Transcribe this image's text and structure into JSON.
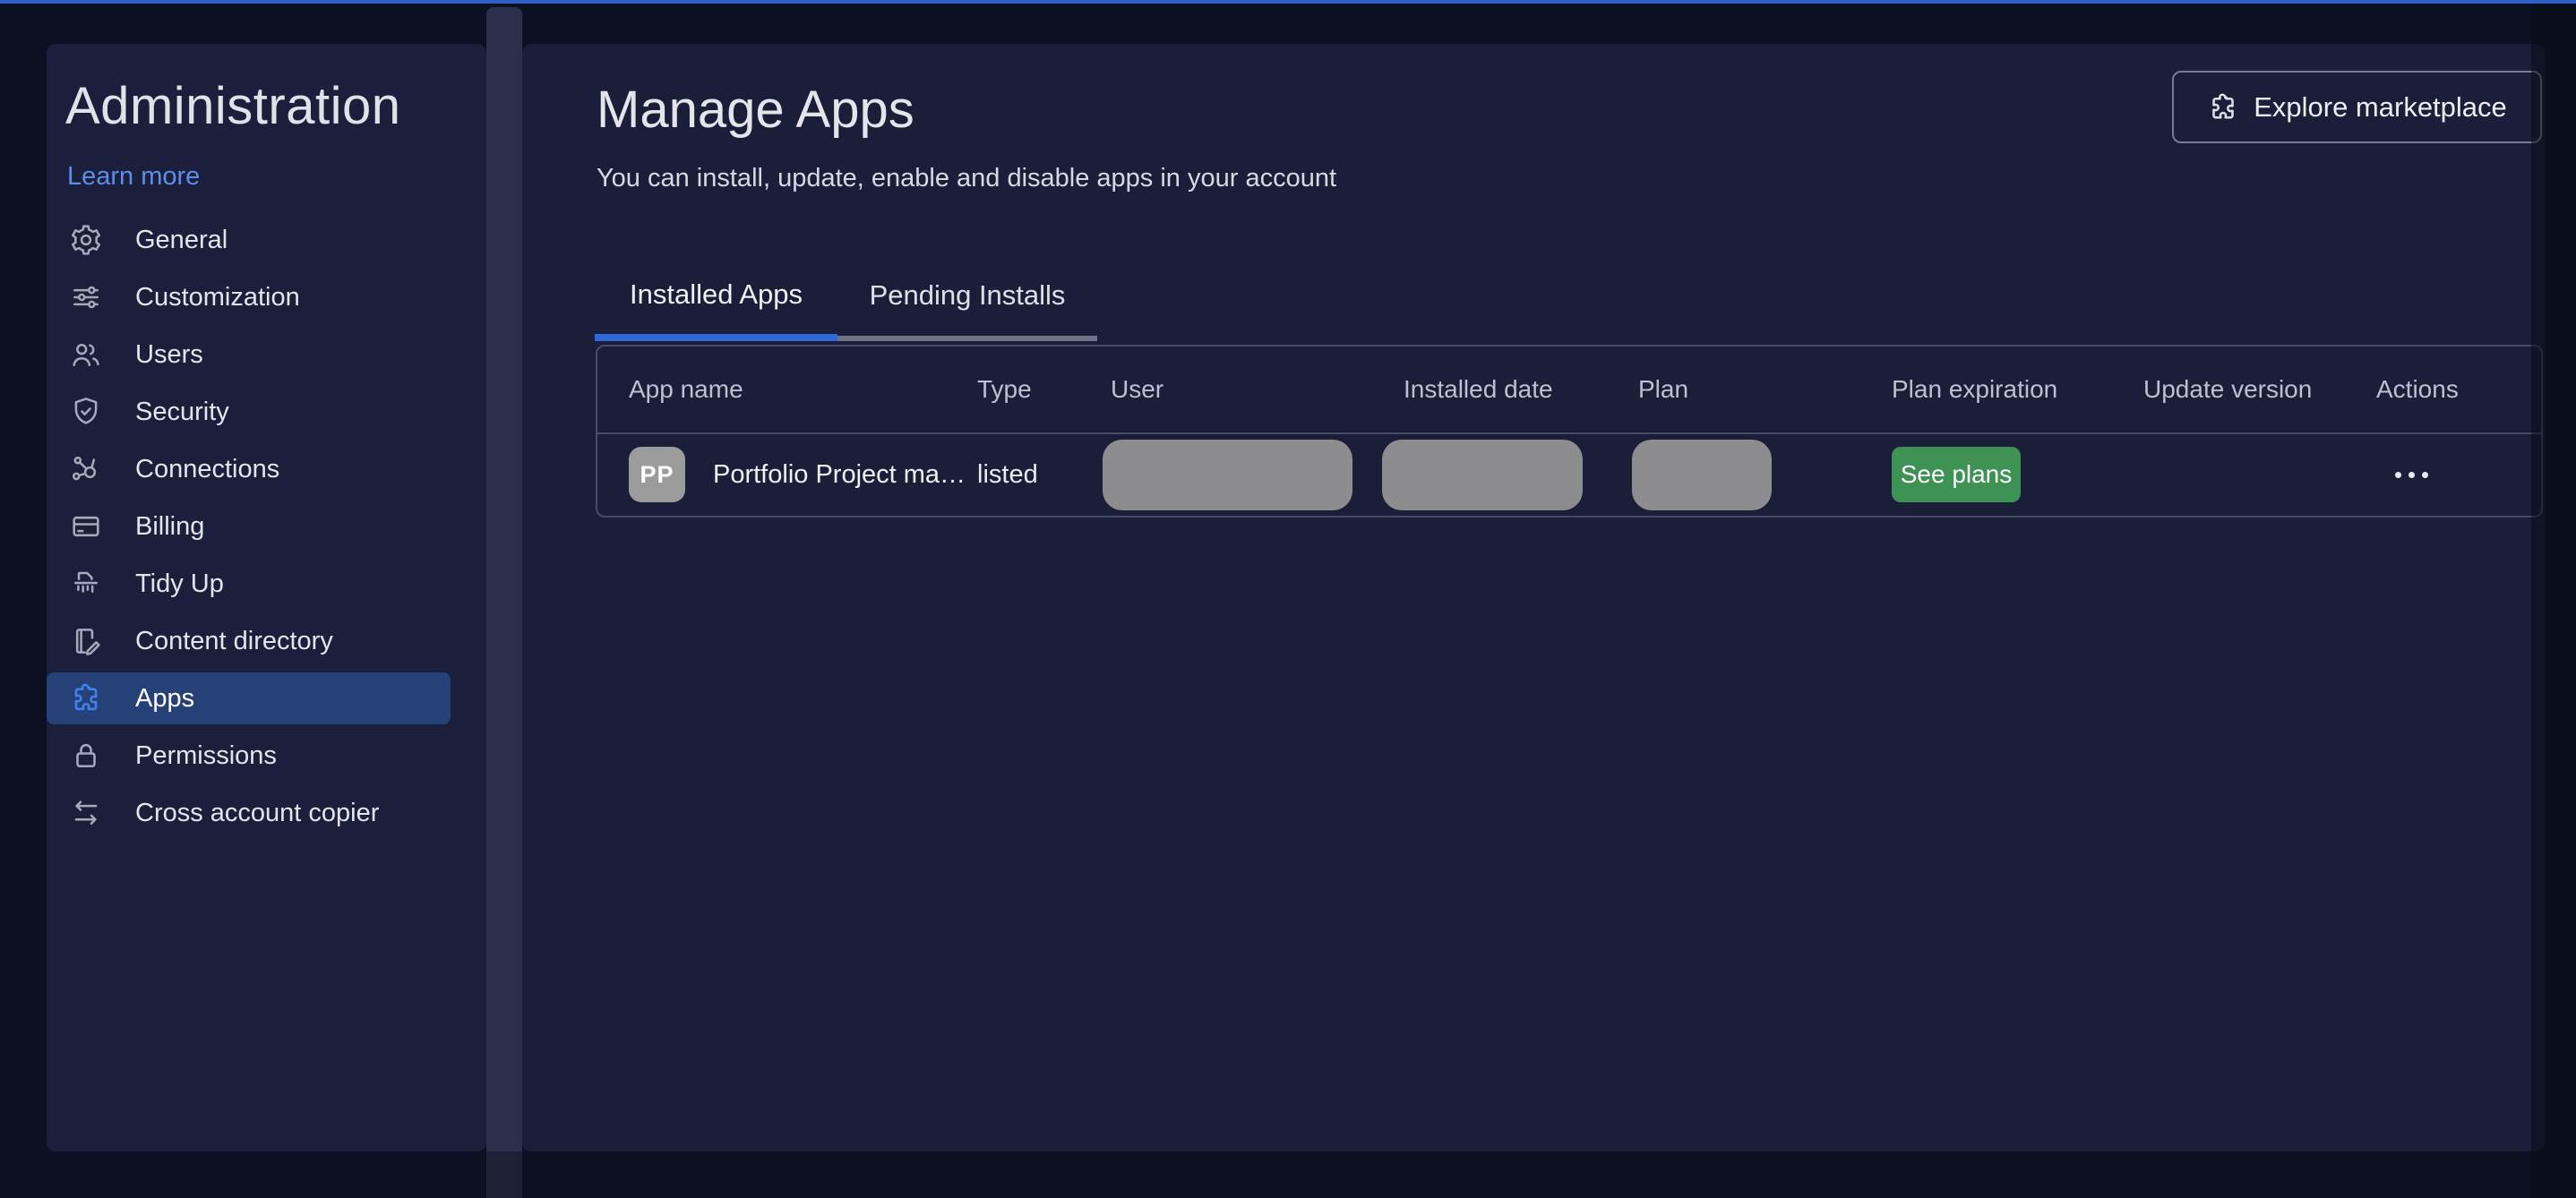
{
  "sidebar": {
    "title": "Administration",
    "learn_more": "Learn more",
    "items": [
      {
        "label": "General",
        "icon": "gear",
        "selected": false
      },
      {
        "label": "Customization",
        "icon": "sliders",
        "selected": false
      },
      {
        "label": "Users",
        "icon": "users",
        "selected": false
      },
      {
        "label": "Security",
        "icon": "shield-check",
        "selected": false
      },
      {
        "label": "Connections",
        "icon": "network-nodes",
        "selected": false
      },
      {
        "label": "Billing",
        "icon": "credit-card",
        "selected": false
      },
      {
        "label": "Tidy Up",
        "icon": "shredder",
        "selected": false
      },
      {
        "label": "Content directory",
        "icon": "document-edit",
        "selected": false
      },
      {
        "label": "Apps",
        "icon": "puzzle",
        "selected": true
      },
      {
        "label": "Permissions",
        "icon": "lock",
        "selected": false
      },
      {
        "label": "Cross account copier",
        "icon": "swap-arrows",
        "selected": false
      }
    ]
  },
  "main": {
    "title": "Manage Apps",
    "subtitle": "You can install, update, enable and disable apps in your account",
    "explore_button": {
      "label": "Explore marketplace",
      "icon": "puzzle"
    },
    "tabs": [
      {
        "label": "Installed Apps",
        "active": true
      },
      {
        "label": "Pending Installs",
        "active": false
      }
    ],
    "table": {
      "columns": [
        "App name",
        "Type",
        "User",
        "Installed date",
        "Plan",
        "Plan expiration",
        "Update version",
        "Actions"
      ],
      "rows": [
        {
          "avatar_initials": "PP",
          "app_name": "Portfolio Project ma…",
          "type": "listed",
          "user": "(redacted)",
          "installed_date": "(redacted)",
          "plan": "(redacted)",
          "plan_expiration_button": "See plans",
          "actions": "more-options"
        }
      ]
    }
  },
  "colors": {
    "accent_blue": "#2e5fc4",
    "link_blue": "#5c8ee9",
    "selected_item_bg": "#264177",
    "selected_icon_blue": "#4080e8",
    "tab_active_underline": "#3168d9",
    "green_button": "#3d9254",
    "redaction_gray": "#8d8d8f",
    "card_bg": "#1b1e39",
    "page_bg": "#0d1023"
  }
}
